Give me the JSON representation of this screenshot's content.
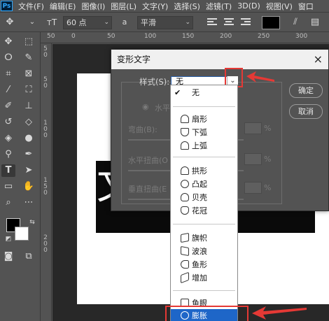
{
  "app": {
    "logo": "Ps"
  },
  "menu": [
    "文件(F)",
    "编辑(E)",
    "图像(I)",
    "图层(L)",
    "文字(Y)",
    "选择(S)",
    "滤镜(T)",
    "3D(D)",
    "视图(V)",
    "窗口"
  ],
  "options_bar": {
    "font_size": "60 点",
    "antialias_icon": "a",
    "antialias": "平滑"
  },
  "rulers": {
    "top": [
      "50",
      "0",
      "50",
      "100",
      "150",
      "200",
      "250",
      "300"
    ],
    "left": [
      "5",
      "0",
      "5",
      "0",
      "1",
      "0",
      "0",
      "1",
      "5",
      "0",
      "2",
      "0",
      "0"
    ]
  },
  "canvas": {
    "text": "文"
  },
  "dialog": {
    "title": "变形文字",
    "close": "×",
    "style_label": "样式(S):",
    "style_value": "无",
    "orientation_label": "水平",
    "bend_label": "弯曲(B):",
    "hdistort_label": "水平扭曲(O",
    "vdistort_label": "垂直扭曲(E",
    "percent": "%",
    "ok_button": "确定",
    "cancel_button": "取消"
  },
  "dropdown": {
    "items": [
      {
        "label": "无",
        "icon": "none",
        "checked": true
      },
      {
        "label": "扇形",
        "icon": "arc-icon"
      },
      {
        "label": "下弧",
        "icon": "arc-lower-icon"
      },
      {
        "label": "上弧",
        "icon": "arc-upper-icon"
      },
      {
        "label": "拱形",
        "icon": "arch-icon"
      },
      {
        "label": "凸起",
        "icon": "bulge-icon"
      },
      {
        "label": "贝壳",
        "icon": "shell-lower-icon"
      },
      {
        "label": "花冠",
        "icon": "shell-upper-icon"
      },
      {
        "label": "旗帜",
        "icon": "flag-icon"
      },
      {
        "label": "波浪",
        "icon": "wave-icon"
      },
      {
        "label": "鱼形",
        "icon": "fish-icon"
      },
      {
        "label": "增加",
        "icon": "rise-icon"
      },
      {
        "label": "鱼眼",
        "icon": "fisheye-icon"
      },
      {
        "label": "膨胀",
        "icon": "inflate-icon",
        "selected": true
      }
    ]
  },
  "colors": {
    "accent_red": "#e53935",
    "select_blue": "#1e66c8"
  }
}
